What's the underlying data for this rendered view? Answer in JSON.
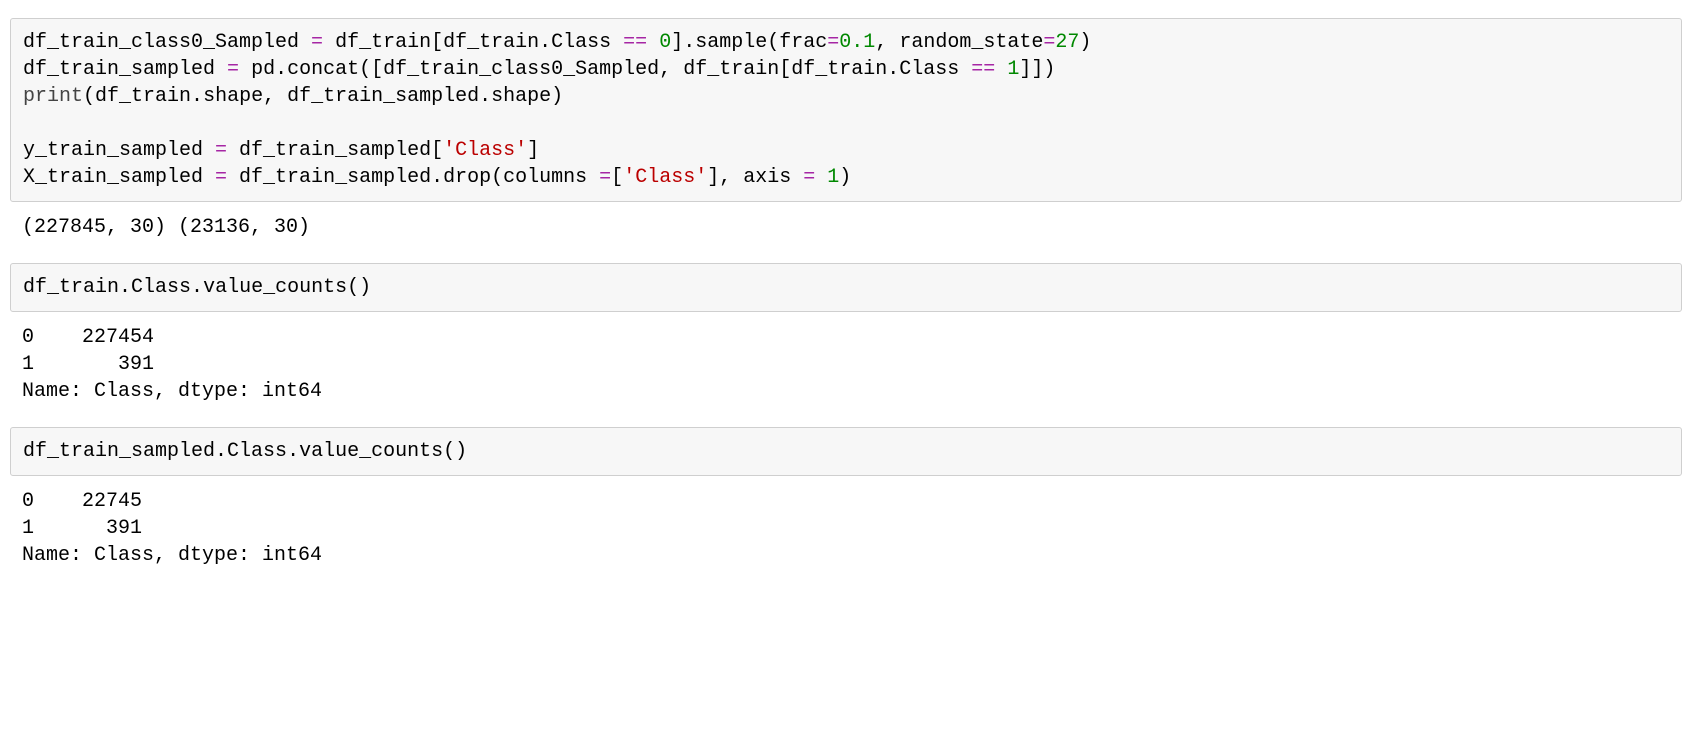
{
  "cells": [
    {
      "type": "code",
      "tokens": [
        [
          "",
          "df_train_class0_Sampled "
        ],
        [
          "op",
          "="
        ],
        [
          "",
          " df_train"
        ],
        [
          "punct",
          "["
        ],
        [
          "",
          "df_train"
        ],
        [
          "punct",
          "."
        ],
        [
          "",
          "Class "
        ],
        [
          "op",
          "=="
        ],
        [
          "",
          " "
        ],
        [
          "num",
          "0"
        ],
        [
          "punct",
          "]"
        ],
        [
          "punct",
          "."
        ],
        [
          "",
          "sample"
        ],
        [
          "punct",
          "("
        ],
        [
          "",
          "frac"
        ],
        [
          "op",
          "="
        ],
        [
          "num",
          "0.1"
        ],
        [
          "punct",
          ","
        ],
        [
          "",
          " random_state"
        ],
        [
          "op",
          "="
        ],
        [
          "num",
          "27"
        ],
        [
          "punct",
          ")"
        ],
        [
          "",
          "\n"
        ],
        [
          "",
          "df_train_sampled "
        ],
        [
          "op",
          "="
        ],
        [
          "",
          " pd"
        ],
        [
          "punct",
          "."
        ],
        [
          "",
          "concat"
        ],
        [
          "punct",
          "("
        ],
        [
          "punct",
          "["
        ],
        [
          "",
          "df_train_class0_Sampled"
        ],
        [
          "punct",
          ","
        ],
        [
          "",
          " df_train"
        ],
        [
          "punct",
          "["
        ],
        [
          "",
          "df_train"
        ],
        [
          "punct",
          "."
        ],
        [
          "",
          "Class "
        ],
        [
          "op",
          "=="
        ],
        [
          "",
          " "
        ],
        [
          "num",
          "1"
        ],
        [
          "punct",
          "]"
        ],
        [
          "punct",
          "]"
        ],
        [
          "punct",
          ")"
        ],
        [
          "",
          "\n"
        ],
        [
          "call",
          "print"
        ],
        [
          "punct",
          "("
        ],
        [
          "",
          "df_train"
        ],
        [
          "punct",
          "."
        ],
        [
          "",
          "shape"
        ],
        [
          "punct",
          ","
        ],
        [
          "",
          " df_train_sampled"
        ],
        [
          "punct",
          "."
        ],
        [
          "",
          "shape"
        ],
        [
          "punct",
          ")"
        ],
        [
          "",
          "\n"
        ],
        [
          "",
          "\n"
        ],
        [
          "",
          "y_train_sampled "
        ],
        [
          "op",
          "="
        ],
        [
          "",
          " df_train_sampled"
        ],
        [
          "punct",
          "["
        ],
        [
          "str",
          "'Class'"
        ],
        [
          "punct",
          "]"
        ],
        [
          "",
          "\n"
        ],
        [
          "",
          "X_train_sampled "
        ],
        [
          "op",
          "="
        ],
        [
          "",
          " df_train_sampled"
        ],
        [
          "punct",
          "."
        ],
        [
          "",
          "drop"
        ],
        [
          "punct",
          "("
        ],
        [
          "",
          "columns "
        ],
        [
          "op",
          "="
        ],
        [
          "punct",
          "["
        ],
        [
          "str",
          "'Class'"
        ],
        [
          "punct",
          "]"
        ],
        [
          "punct",
          ","
        ],
        [
          "",
          " axis "
        ],
        [
          "op",
          "="
        ],
        [
          "",
          " "
        ],
        [
          "num",
          "1"
        ],
        [
          "punct",
          ")"
        ]
      ]
    },
    {
      "type": "output",
      "text": "(227845, 30) (23136, 30)"
    },
    {
      "type": "code",
      "tokens": [
        [
          "",
          "df_train"
        ],
        [
          "punct",
          "."
        ],
        [
          "",
          "Class"
        ],
        [
          "punct",
          "."
        ],
        [
          "",
          "value_counts"
        ],
        [
          "punct",
          "("
        ],
        [
          "punct",
          ")"
        ]
      ]
    },
    {
      "type": "output",
      "text": "0    227454\n1       391\nName: Class, dtype: int64"
    },
    {
      "type": "code",
      "tokens": [
        [
          "",
          "df_train_sampled"
        ],
        [
          "punct",
          "."
        ],
        [
          "",
          "Class"
        ],
        [
          "punct",
          "."
        ],
        [
          "",
          "value_counts"
        ],
        [
          "punct",
          "("
        ],
        [
          "punct",
          ")"
        ]
      ]
    },
    {
      "type": "output",
      "text": "0    22745\n1      391\nName: Class, dtype: int64"
    }
  ]
}
